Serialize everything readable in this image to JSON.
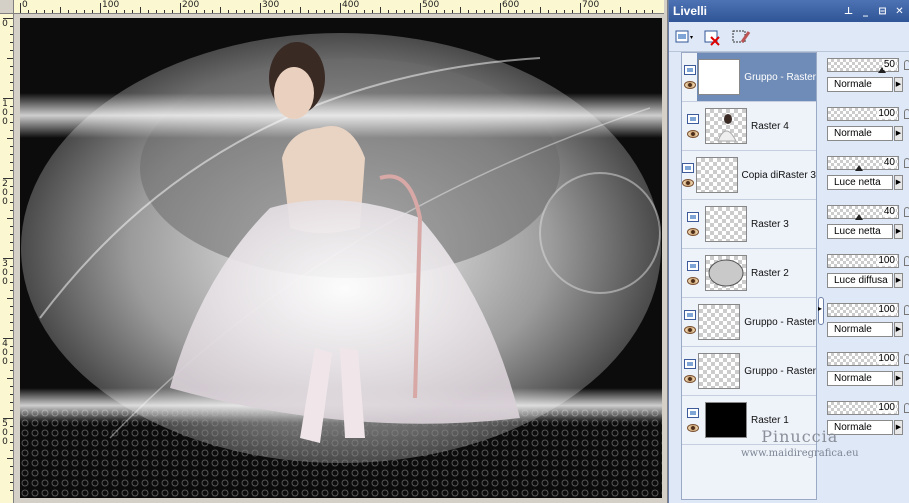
{
  "window": {
    "title": "Livelli",
    "pin": "⊥",
    "minimize": "_",
    "restore": "⊟",
    "close": "✕"
  },
  "rulers": {
    "top_labels": [
      "0",
      "100",
      "200",
      "300",
      "400",
      "500",
      "600",
      "700"
    ],
    "left_labels": [
      "0",
      "1 0 0",
      "2 0 0",
      "3 0 0",
      "4 0 0",
      "5 0 0"
    ]
  },
  "toolbar": [
    {
      "name": "new-layer-icon",
      "glyph": "▣▾"
    },
    {
      "name": "delete-layer-icon",
      "glyph": "✕"
    },
    {
      "name": "edit-selection-icon",
      "glyph": "✎"
    }
  ],
  "layers": [
    {
      "name": "Gruppo - Raster",
      "thumb": "white",
      "opacity": "50",
      "blend": "Normale",
      "slider": true,
      "selected": true
    },
    {
      "name": "Raster 4",
      "thumb": "dancer",
      "opacity": "100",
      "blend": "Normale",
      "slider": false,
      "selected": false
    },
    {
      "name": "Copia diRaster 3",
      "thumb": "checker",
      "opacity": "40",
      "blend": "Luce netta",
      "slider": true,
      "selected": false
    },
    {
      "name": "Raster 3",
      "thumb": "checker",
      "opacity": "40",
      "blend": "Luce netta",
      "slider": true,
      "selected": false
    },
    {
      "name": "Raster 2",
      "thumb": "oval",
      "opacity": "100",
      "blend": "Luce diffusa",
      "slider": false,
      "selected": false
    },
    {
      "name": "Gruppo - Raster",
      "thumb": "checker",
      "opacity": "100",
      "blend": "Normale",
      "slider": false,
      "selected": false
    },
    {
      "name": "Gruppo - Raster",
      "thumb": "checker",
      "opacity": "100",
      "blend": "Normale",
      "slider": false,
      "selected": false
    },
    {
      "name": "Raster 1",
      "thumb": "black",
      "opacity": "100",
      "blend": "Normale",
      "slider": false,
      "selected": false
    }
  ],
  "watermark": {
    "name": "Pinuccia",
    "site": "www.maidiregrafica.eu"
  }
}
